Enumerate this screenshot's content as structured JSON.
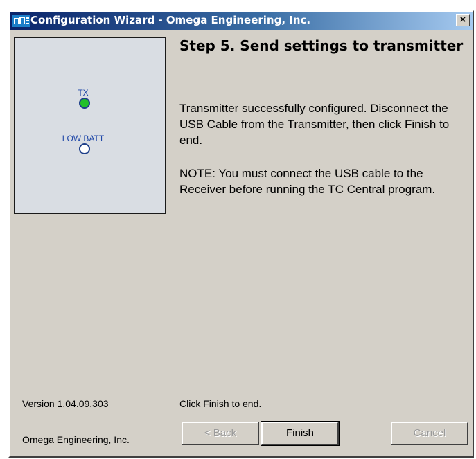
{
  "window": {
    "title": "Configuration Wizard - Omega Engineering, Inc.",
    "close_label": "×"
  },
  "device": {
    "tx_label": "TX",
    "tx_color": "#22c02a",
    "low_batt_label": "LOW BATT",
    "low_batt_color": "#ffffff"
  },
  "step": {
    "title": "Step 5.  Send settings to transmitter",
    "message": "Transmitter successfully configured. Disconnect the USB Cable from the Transmitter, then click Finish to end.",
    "note": "NOTE:  You must connect the USB cable to the Receiver before running the TC Central program."
  },
  "footer": {
    "version": "Version 1.04.09.303",
    "company": "Omega Engineering, Inc.",
    "hint": "Click Finish to end."
  },
  "buttons": {
    "back": "< Back",
    "finish": "Finish",
    "cancel": "Cancel"
  }
}
